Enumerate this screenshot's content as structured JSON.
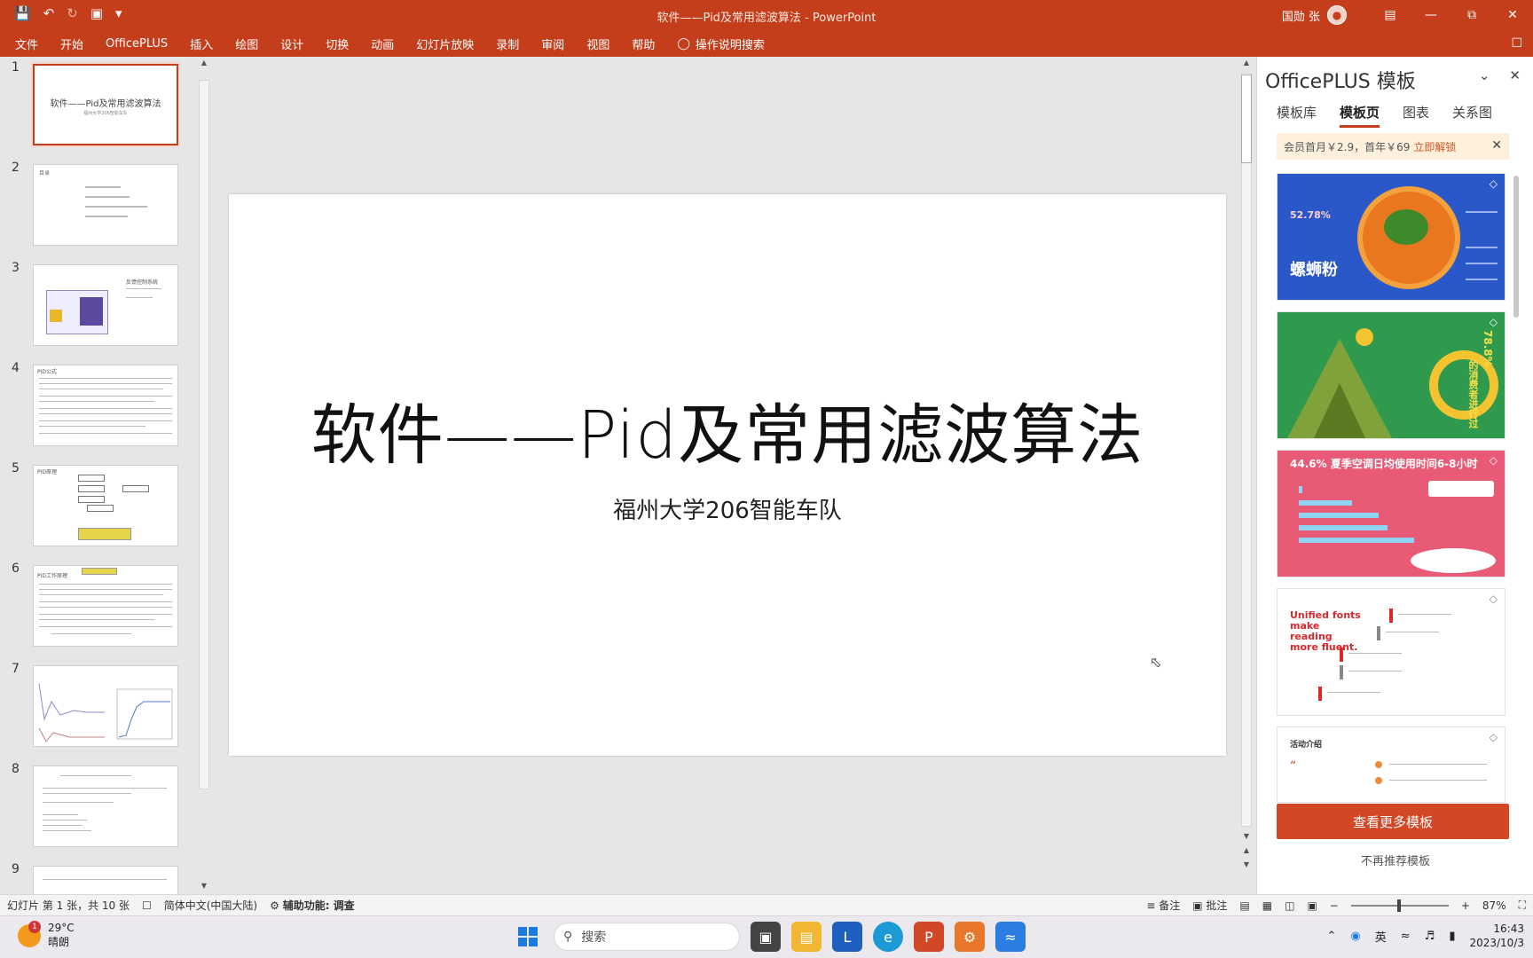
{
  "titlebar": {
    "title": "软件——Pid及常用滤波算法 - PowerPoint",
    "user": "国勋 张"
  },
  "menu": {
    "items": [
      "文件",
      "开始",
      "OfficePLUS",
      "插入",
      "绘图",
      "设计",
      "切换",
      "动画",
      "幻灯片放映",
      "录制",
      "审阅",
      "视图",
      "帮助"
    ],
    "tell_me": "操作说明搜索"
  },
  "thumbnails": {
    "numbers": [
      "1",
      "2",
      "3",
      "4",
      "5",
      "6",
      "7",
      "8",
      "9"
    ],
    "slide1_title": "软件——Pid及常用滤波算法",
    "slide1_sub": "福州大学206智能车队",
    "slide2_title": "目录",
    "slide3_title": "反馈控制系统",
    "slide4_title": "PID公式",
    "slide5_title": "PID原理",
    "slide6_title": "PID工作原理"
  },
  "slide": {
    "title": "软件——Pid及常用滤波算法",
    "subtitle": "福州大学206智能车队"
  },
  "panel": {
    "title": "OfficePLUS 模板",
    "tabs": [
      "模板库",
      "模板页",
      "图表",
      "关系图"
    ],
    "active_tab": "模板页",
    "promo_text": "会员首月￥2.9，首年￥69",
    "promo_link": "立即解锁",
    "templates": [
      {
        "label": "螺蛳粉",
        "stat": "52.78%",
        "bg": "#2b58c9"
      },
      {
        "label": "的消费者进行过",
        "stat": "78.8%",
        "bg": "#2f9a4d"
      },
      {
        "label": "夏季空调日均使用时间6-8小时",
        "stat": "44.6%",
        "bg": "#e85a75"
      },
      {
        "label": "Unified fonts make reading more fluent.",
        "stat": "",
        "bg": "#ffffff"
      },
      {
        "label": "活动介绍",
        "stat": "",
        "bg": "#ffffff"
      }
    ],
    "more_button": "查看更多模板",
    "no_recommend": "不再推荐模板"
  },
  "status": {
    "slide_info": "幻灯片 第 1 张，共 10 张",
    "language": "简体中文(中国大陆)",
    "accessibility": "辅助功能: 调查",
    "notes": "备注",
    "comments": "批注",
    "zoom": "87%"
  },
  "taskbar": {
    "temperature": "29°C",
    "weather": "晴朗",
    "badge": "1",
    "search_placeholder": "搜索",
    "ime": "英",
    "time": "16:43",
    "date": "2023/10/3"
  }
}
